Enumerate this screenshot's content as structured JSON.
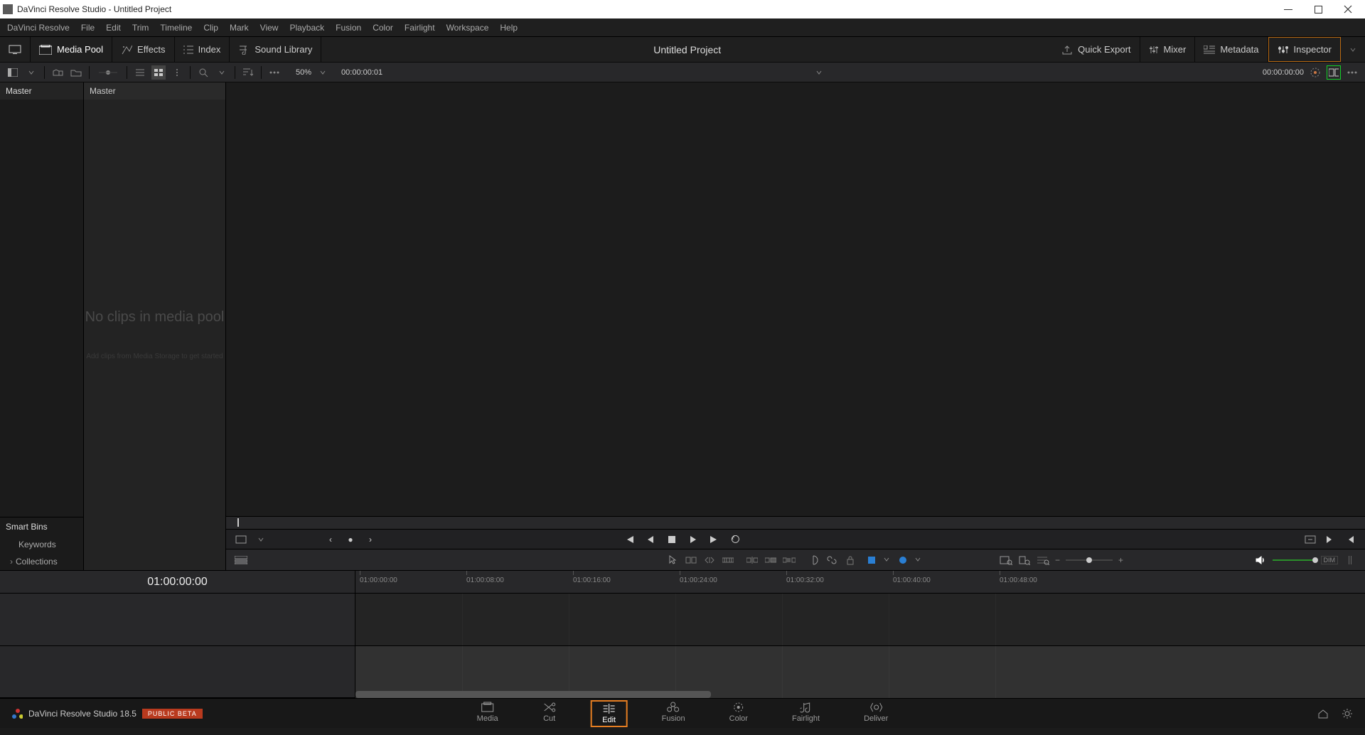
{
  "titlebar": {
    "title": "DaVinci Resolve Studio - Untitled Project"
  },
  "menubar": [
    "DaVinci Resolve",
    "File",
    "Edit",
    "Trim",
    "Timeline",
    "Clip",
    "Mark",
    "View",
    "Playback",
    "Fusion",
    "Color",
    "Fairlight",
    "Workspace",
    "Help"
  ],
  "uibar": {
    "left": [
      {
        "label": "Media Pool",
        "active": true
      },
      {
        "label": "Effects"
      },
      {
        "label": "Index"
      },
      {
        "label": "Sound Library"
      }
    ],
    "title": "Untitled Project",
    "right": [
      {
        "label": "Quick Export"
      },
      {
        "label": "Mixer"
      },
      {
        "label": "Metadata"
      },
      {
        "label": "Inspector",
        "boxed": true
      }
    ]
  },
  "toolbar": {
    "zoom": "50%",
    "tc_left": "00:00:00:01",
    "tc_right": "00:00:00:00"
  },
  "sidebar": {
    "header": "Master",
    "smart_bins_title": "Smart Bins",
    "smart_bins": [
      "Keywords",
      "Collections"
    ]
  },
  "mediapool": {
    "header": "Master",
    "empty_msg": "No clips in media pool",
    "empty_hint": "Add clips from Media Storage to get started"
  },
  "edit_tools": {
    "dim": "DIM"
  },
  "timeline": {
    "tc": "01:00:00:00",
    "ticks": [
      "01:00:00:00",
      "01:00:08:00",
      "01:00:16:00",
      "01:00:24:00",
      "01:00:32:00",
      "01:00:40:00",
      "01:00:48:00"
    ]
  },
  "pagebar": {
    "app_name": "DaVinci Resolve Studio 18.5",
    "beta": "PUBLIC BETA",
    "pages": [
      "Media",
      "Cut",
      "Edit",
      "Fusion",
      "Color",
      "Fairlight",
      "Deliver"
    ],
    "active_page": "Edit"
  }
}
